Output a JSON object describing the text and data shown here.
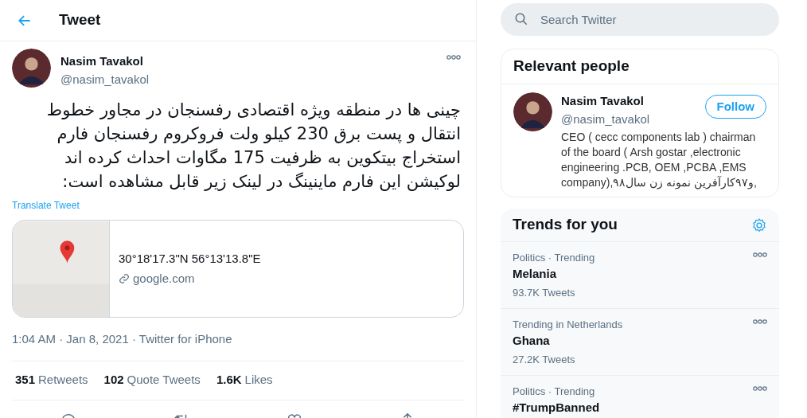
{
  "header": {
    "title": "Tweet"
  },
  "tweet": {
    "author": {
      "name": "Nasim Tavakol",
      "handle": "@nasim_tavakol"
    },
    "text": "چینی ها در منطقه ویژه اقتصادی رفسنجان در مجاور خطوط انتقال و پست برق 230 کیلو ولت فروکروم رفسنجان فارم استخراج بیتکوین به ظرفیت 175 مگاوات احداث کرده اند لوکیشن این فارم ماینینگ در لینک زیر قابل مشاهده است:",
    "translate": "Translate Tweet",
    "card": {
      "title": "30°18'17.3\"N 56°13'13.8\"E",
      "domain": "google.com"
    },
    "meta": "1:04 AM · Jan 8, 2021 · Twitter for iPhone",
    "stats": [
      {
        "count": "351",
        "label": "Retweets"
      },
      {
        "count": "102",
        "label": "Quote Tweets"
      },
      {
        "count": "1.6K",
        "label": "Likes"
      }
    ]
  },
  "search": {
    "placeholder": "Search Twitter"
  },
  "relevant_people": {
    "title": "Relevant people",
    "people": [
      {
        "name": "Nasim Tavakol",
        "handle": "@nasim_tavakol",
        "button": "Follow",
        "bio": "CEO ( cecc components lab ) chairman of the board ( Arsh gostar ,electronic engineering .PCB, OEM ,PCBA ,EMS company),۹۸و۹۷کارآفرین نمونه زن سال,"
      }
    ]
  },
  "trends": {
    "title": "Trends for you",
    "items": [
      {
        "context": "Politics · Trending",
        "name": "Melania",
        "count": "93.7K Tweets"
      },
      {
        "context": "Trending in Netherlands",
        "name": "Ghana",
        "count": "27.2K Tweets"
      },
      {
        "context": "Politics · Trending",
        "name": "#TrumpBanned"
      }
    ]
  }
}
